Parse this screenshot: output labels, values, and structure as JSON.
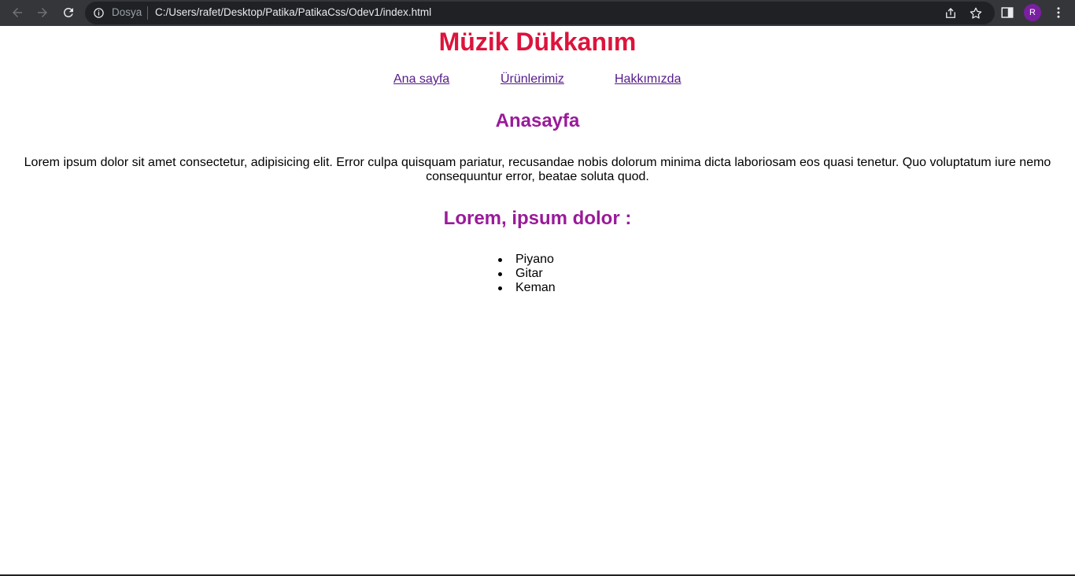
{
  "browser": {
    "site_chip": "Dosya",
    "url": "C:/Users/rafet/Desktop/Patika/PatikaCss/Odev1/index.html",
    "profile_initial": "R",
    "profile_color": "#7b1fa2",
    "icons": [
      "back-icon",
      "forward-icon",
      "reload-icon",
      "info-icon",
      "share-icon",
      "star-icon",
      "side-panel-icon",
      "menu-icon"
    ]
  },
  "page": {
    "title": "Müzik Dükkanım",
    "title_color": "#dc143c",
    "nav": [
      "Ana sayfa",
      "Ürünlerimiz",
      "Hakkımızda"
    ],
    "section_heading": "Anasayfa",
    "heading_color": "#9a1a9a",
    "paragraph": "Lorem ipsum dolor sit amet consectetur, adipisicing elit. Error culpa quisquam pariatur, recusandae nobis dolorum minima dicta laboriosam eos quasi tenetur. Quo voluptatum iure nemo consequuntur error, beatae soluta quod.",
    "list_heading": "Lorem, ipsum dolor :",
    "list_items": [
      "Piyano",
      "Gitar",
      "Keman"
    ]
  }
}
